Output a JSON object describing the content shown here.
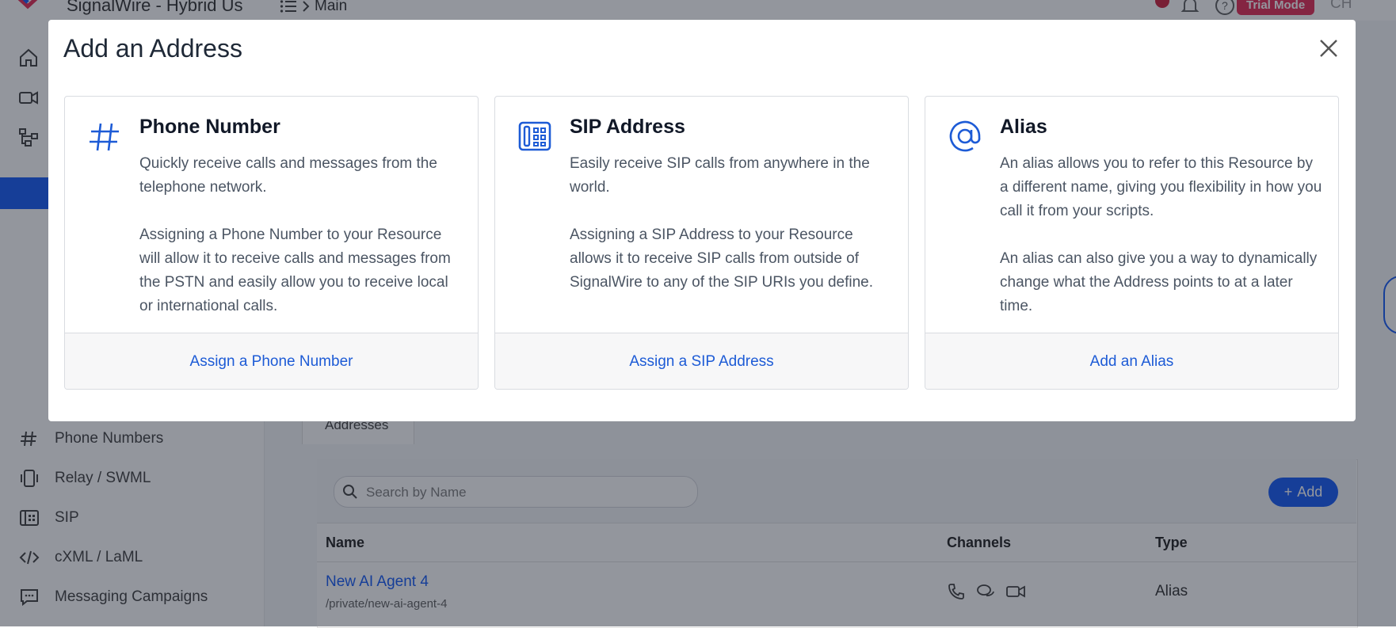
{
  "app": {
    "title": "SignalWire - Hybrid Us",
    "breadcrumb": "Main",
    "trial_badge": "Trial Mode",
    "avatar_initials": "CH",
    "accent_color": "#044ef4"
  },
  "sidebar": {
    "items": [
      {
        "label": "Phone Numbers",
        "icon": "hash-icon"
      },
      {
        "label": "Relay / SWML",
        "icon": "relay-icon"
      },
      {
        "label": "SIP",
        "icon": "sip-icon"
      },
      {
        "label": "cXML / LaML",
        "icon": "code-icon"
      },
      {
        "label": "Messaging Campaigns",
        "icon": "chat-icon"
      }
    ]
  },
  "main": {
    "tab_label": "Addresses",
    "search_placeholder": "Search by Name",
    "add_button": "Add",
    "columns": [
      "Name",
      "Channels",
      "Type"
    ],
    "rows": [
      {
        "name": "New AI Agent 4",
        "path": "/private/new-ai-agent-4",
        "channels": [
          "phone-icon",
          "chat-icon",
          "video-icon"
        ],
        "type": "Alias"
      }
    ]
  },
  "modal": {
    "title": "Add an Address",
    "cards": [
      {
        "icon": "hash-icon",
        "title": "Phone Number",
        "para1": "Quickly receive calls and messages from the telephone network.",
        "para2": "Assigning a Phone Number to your Resource will allow it to receive calls and messages from the PSTN and easily allow you to receive local or international calls.",
        "action": "Assign a Phone Number"
      },
      {
        "icon": "sip-phone-icon",
        "title": "SIP Address",
        "para1": "Easily receive SIP calls from anywhere in the world.",
        "para2": "Assigning a SIP Address to your Resource allows it to receive SIP calls from outside of SignalWire to any of the SIP URIs you define.",
        "action": "Assign a SIP Address"
      },
      {
        "icon": "at-icon",
        "title": "Alias",
        "para1": "An alias allows you to refer to this Resource by a different name, giving you flexibility in how you call it from your scripts.",
        "para2": "An alias can also give you a way to dynamically change what the Address points to at a later time.",
        "action": "Add an Alias"
      }
    ]
  }
}
